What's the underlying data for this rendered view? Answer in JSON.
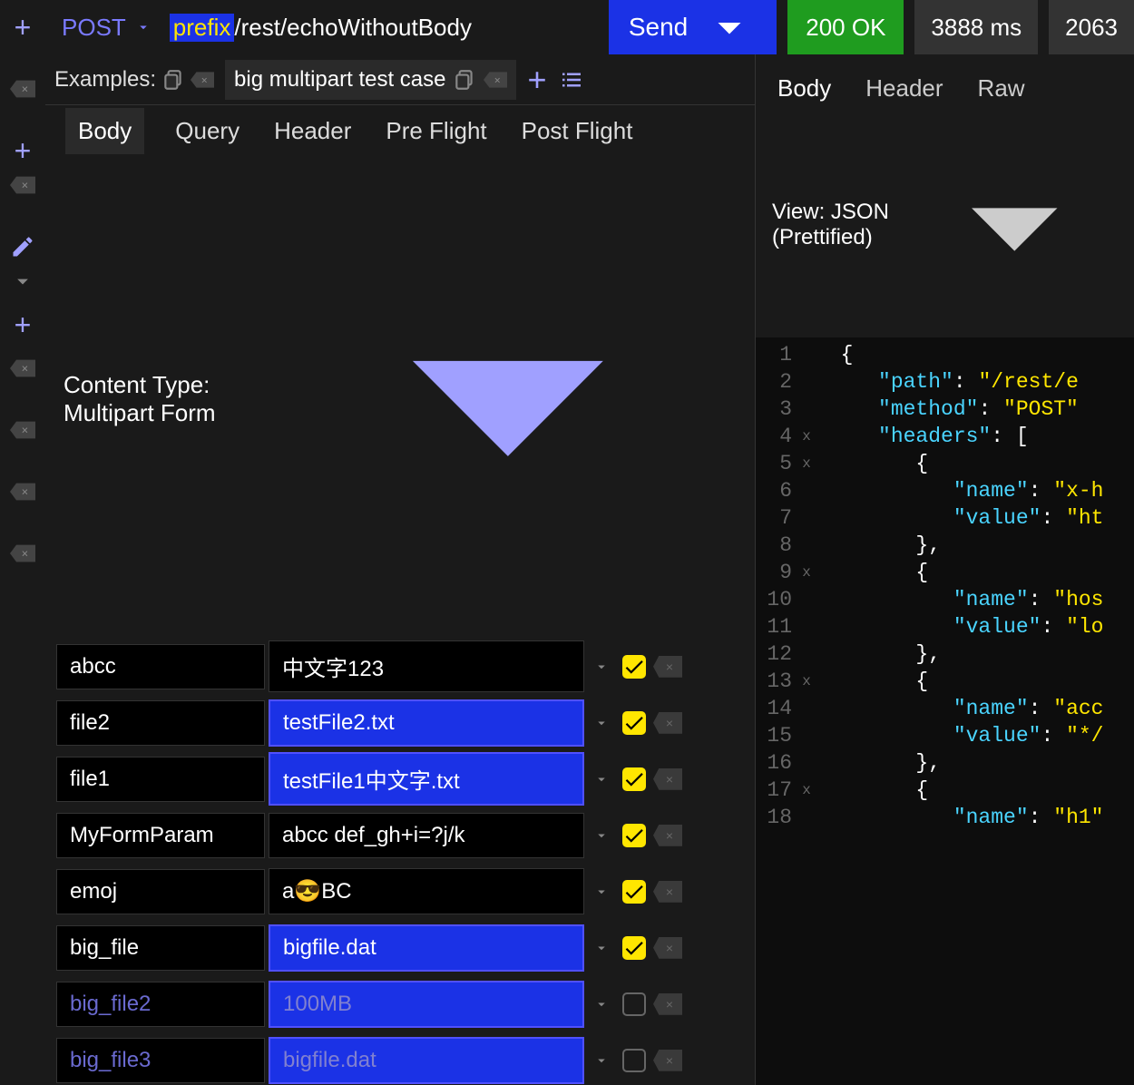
{
  "request": {
    "method": "POST",
    "url_prefix": "prefix",
    "url_path": "/rest/echoWithoutBody",
    "send_label": "Send"
  },
  "status": {
    "code": "200 OK",
    "time": "3888 ms",
    "size": "2063"
  },
  "examples": {
    "label": "Examples:",
    "active": "big multipart test case"
  },
  "req_tabs": [
    "Body",
    "Query",
    "Header",
    "Pre Flight",
    "Post Flight"
  ],
  "content_type": "Content Type: Multipart Form",
  "form": [
    {
      "key": "abcc",
      "val": "中文字123",
      "type": "text",
      "enabled": true
    },
    {
      "key": "file2",
      "val": "testFile2.txt",
      "type": "file",
      "enabled": true
    },
    {
      "key": "file1",
      "val": "testFile1中文字.txt",
      "type": "file",
      "enabled": true
    },
    {
      "key": "MyFormParam",
      "val": "abcc def_gh+i=?j/k",
      "type": "text",
      "enabled": true
    },
    {
      "key": "emoj",
      "val": "a😎BC",
      "type": "text",
      "enabled": true
    },
    {
      "key": "big_file",
      "val": "bigfile.dat",
      "type": "file",
      "enabled": true
    },
    {
      "key": "big_file2",
      "val": "100MB",
      "type": "file",
      "enabled": false
    },
    {
      "key": "big_file3",
      "val": "bigfile.dat",
      "type": "file",
      "enabled": false
    }
  ],
  "resp_tabs": [
    "Body",
    "Header",
    "Raw"
  ],
  "view_label": "View: JSON (Prettified)",
  "json_lines": [
    {
      "n": 1,
      "fold": "",
      "indent": 0,
      "tokens": [
        {
          "t": "punc",
          "v": "{"
        }
      ]
    },
    {
      "n": 2,
      "fold": "",
      "indent": 1,
      "tokens": [
        {
          "t": "key",
          "v": "\"path\""
        },
        {
          "t": "punc",
          "v": ": "
        },
        {
          "t": "str",
          "v": "\"/rest/e"
        }
      ]
    },
    {
      "n": 3,
      "fold": "",
      "indent": 1,
      "tokens": [
        {
          "t": "key",
          "v": "\"method\""
        },
        {
          "t": "punc",
          "v": ": "
        },
        {
          "t": "str",
          "v": "\"POST\""
        }
      ]
    },
    {
      "n": 4,
      "fold": "x",
      "indent": 1,
      "tokens": [
        {
          "t": "key",
          "v": "\"headers\""
        },
        {
          "t": "punc",
          "v": ": ["
        }
      ]
    },
    {
      "n": 5,
      "fold": "x",
      "indent": 2,
      "tokens": [
        {
          "t": "punc",
          "v": "{"
        }
      ]
    },
    {
      "n": 6,
      "fold": "",
      "indent": 3,
      "tokens": [
        {
          "t": "key",
          "v": "\"name\""
        },
        {
          "t": "punc",
          "v": ": "
        },
        {
          "t": "str",
          "v": "\"x-h"
        }
      ]
    },
    {
      "n": 7,
      "fold": "",
      "indent": 3,
      "tokens": [
        {
          "t": "key",
          "v": "\"value\""
        },
        {
          "t": "punc",
          "v": ": "
        },
        {
          "t": "str",
          "v": "\"ht"
        }
      ]
    },
    {
      "n": 8,
      "fold": "",
      "indent": 2,
      "tokens": [
        {
          "t": "punc",
          "v": "},"
        }
      ]
    },
    {
      "n": 9,
      "fold": "x",
      "indent": 2,
      "tokens": [
        {
          "t": "punc",
          "v": "{"
        }
      ]
    },
    {
      "n": 10,
      "fold": "",
      "indent": 3,
      "tokens": [
        {
          "t": "key",
          "v": "\"name\""
        },
        {
          "t": "punc",
          "v": ": "
        },
        {
          "t": "str",
          "v": "\"hos"
        }
      ]
    },
    {
      "n": 11,
      "fold": "",
      "indent": 3,
      "tokens": [
        {
          "t": "key",
          "v": "\"value\""
        },
        {
          "t": "punc",
          "v": ": "
        },
        {
          "t": "str",
          "v": "\"lo"
        }
      ]
    },
    {
      "n": 12,
      "fold": "",
      "indent": 2,
      "tokens": [
        {
          "t": "punc",
          "v": "},"
        }
      ]
    },
    {
      "n": 13,
      "fold": "x",
      "indent": 2,
      "tokens": [
        {
          "t": "punc",
          "v": "{"
        }
      ]
    },
    {
      "n": 14,
      "fold": "",
      "indent": 3,
      "tokens": [
        {
          "t": "key",
          "v": "\"name\""
        },
        {
          "t": "punc",
          "v": ": "
        },
        {
          "t": "str",
          "v": "\"acc"
        }
      ]
    },
    {
      "n": 15,
      "fold": "",
      "indent": 3,
      "tokens": [
        {
          "t": "key",
          "v": "\"value\""
        },
        {
          "t": "punc",
          "v": ": "
        },
        {
          "t": "str",
          "v": "\"*/"
        }
      ]
    },
    {
      "n": 16,
      "fold": "",
      "indent": 2,
      "tokens": [
        {
          "t": "punc",
          "v": "},"
        }
      ]
    },
    {
      "n": 17,
      "fold": "x",
      "indent": 2,
      "tokens": [
        {
          "t": "punc",
          "v": "{"
        }
      ]
    },
    {
      "n": 18,
      "fold": "",
      "indent": 3,
      "tokens": [
        {
          "t": "key",
          "v": "\"name\""
        },
        {
          "t": "punc",
          "v": ": "
        },
        {
          "t": "str",
          "v": "\"h1\""
        }
      ]
    }
  ]
}
